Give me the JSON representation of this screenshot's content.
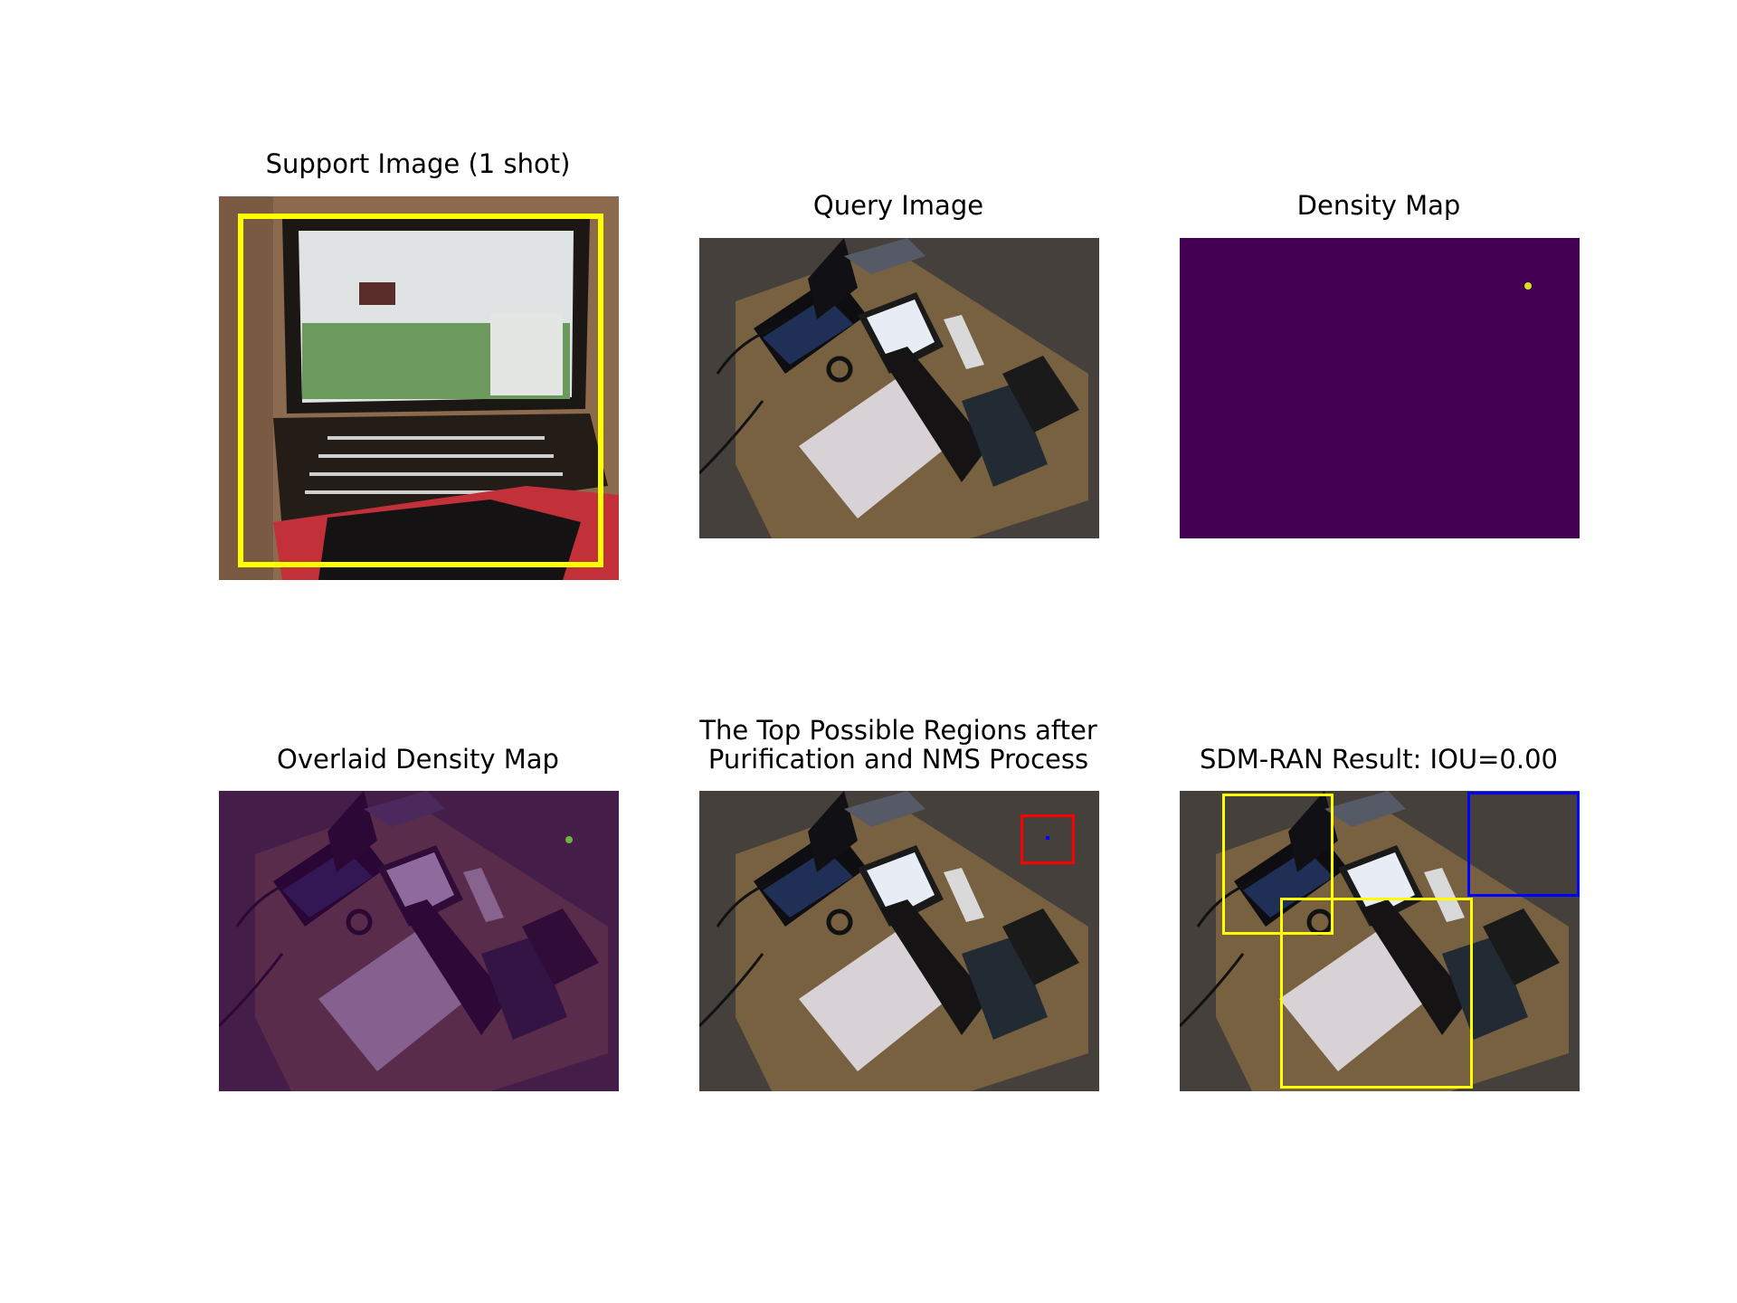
{
  "figure": {
    "panels": [
      {
        "id": "support",
        "title": "Support Image (1 shot)"
      },
      {
        "id": "query",
        "title": "Query Image"
      },
      {
        "id": "density",
        "title": "Density Map"
      },
      {
        "id": "overlaid",
        "title": "Overlaid Density Map"
      },
      {
        "id": "regions",
        "title_line1": "The Top Possible Regions after",
        "title_line2": "Purification and NMS Process"
      },
      {
        "id": "result",
        "title": "SDM-RAN Result: IOU=0.00"
      }
    ],
    "colors": {
      "density_background": "#440154",
      "density_peak": "#d4e021",
      "support_box": "#ffff00",
      "candidate_box": "#ff0000",
      "prediction_box": "#ffff00",
      "ground_truth_box": "#0000ff"
    }
  }
}
